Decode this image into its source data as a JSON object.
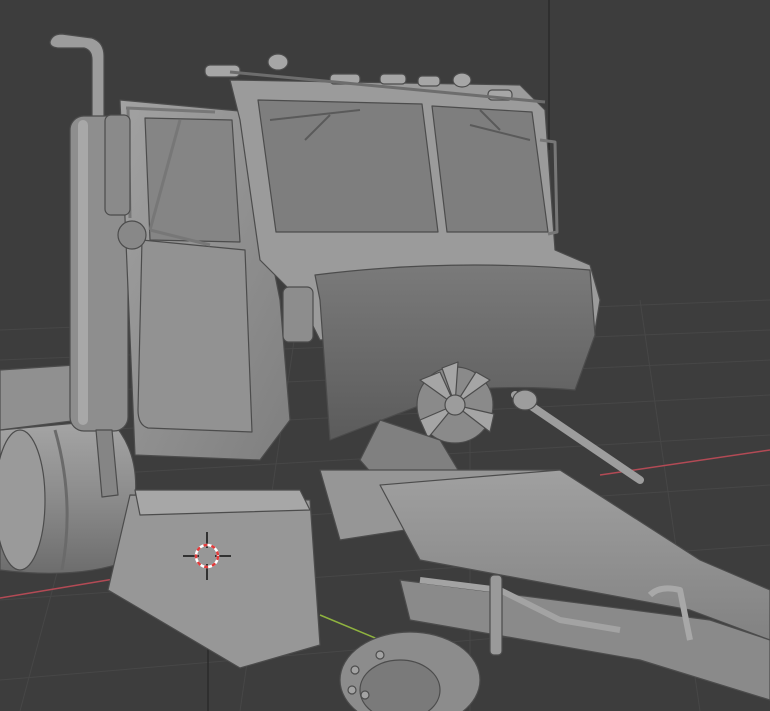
{
  "viewport": {
    "background": "#3d3d3d",
    "grid_color": "#4a4a4a",
    "x_axis_color": "#b34a55",
    "y_axis_color": "#8fb33f",
    "z_axis_color": "#2b2b2b"
  },
  "model": {
    "icon": "truck-model-icon",
    "base_color": "#8f8f8f",
    "light_color": "#a9a9a9",
    "shadow_color": "#5f5f5f"
  },
  "cursor": {
    "icon": "3d-cursor-icon",
    "ring_color_a": "#e23b3b",
    "ring_color_b": "#ffffff"
  }
}
